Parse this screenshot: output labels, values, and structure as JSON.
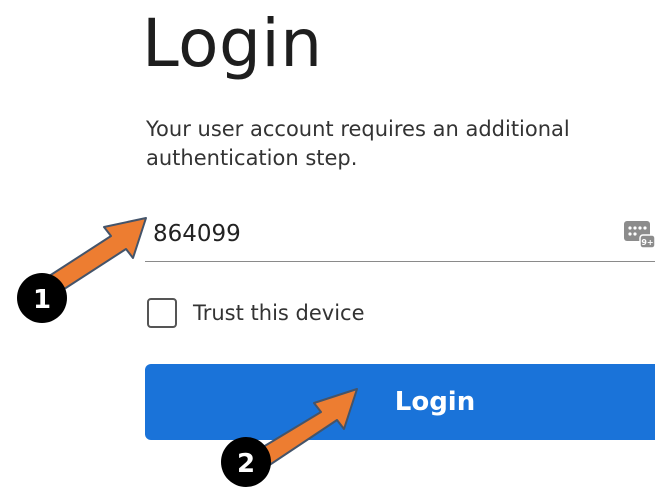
{
  "page": {
    "title": "Login",
    "subtitle": "Your user account requires an additional authentication step."
  },
  "code_field": {
    "value": "864099",
    "keypad_icon_badge": "9+"
  },
  "trust_device": {
    "label": "Trust this device",
    "checked": false
  },
  "login_button": {
    "label": "Login",
    "color": "#1a73d9"
  },
  "annotations": {
    "arrow_color": "#ed7d31",
    "step_badges": [
      "1",
      "2"
    ]
  }
}
